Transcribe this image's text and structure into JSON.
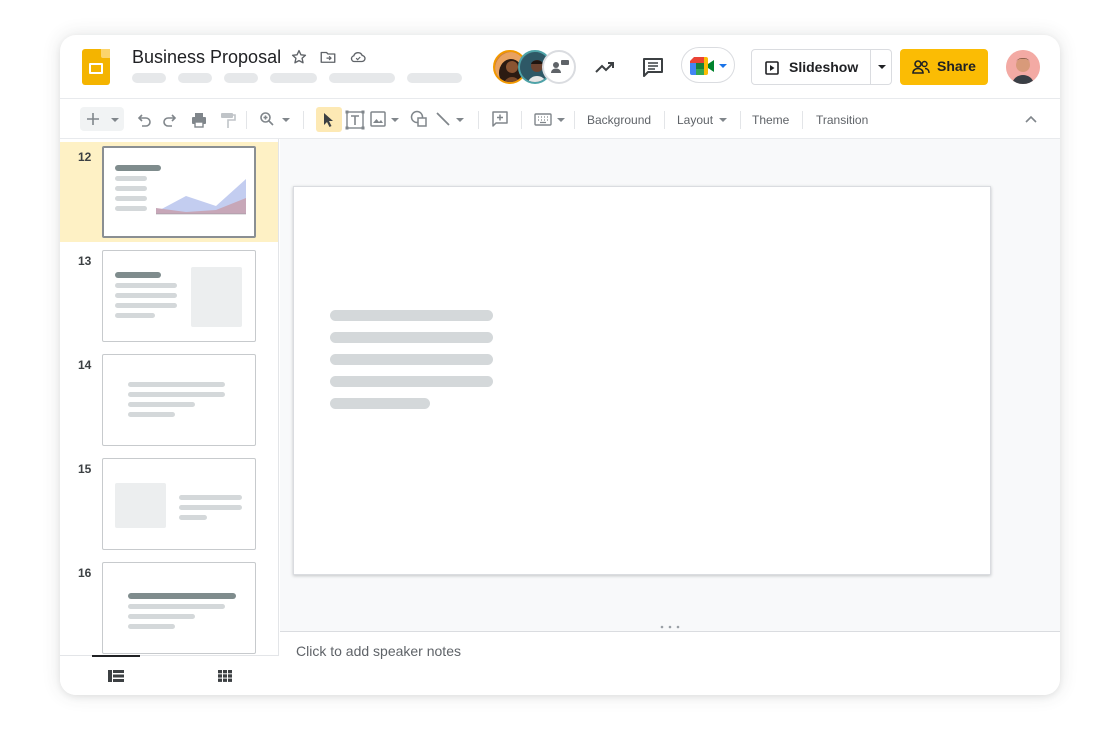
{
  "app": {
    "title": "Business Proposal",
    "brand_color": "#f4b400",
    "accent_color": "#fbbc04"
  },
  "header": {
    "icons": [
      "star-icon",
      "move-to-folder-icon",
      "cloud-saved-icon",
      "activity-trend-icon",
      "comments-icon",
      "google-meet-icon"
    ],
    "collaborators": [
      "collaborator-avatar-1",
      "collaborator-avatar-2",
      "more-collaborators-icon"
    ],
    "slideshow_label": "Slideshow",
    "share_label": "Share"
  },
  "toolbar": {
    "background_label": "Background",
    "layout_label": "Layout",
    "theme_label": "Theme",
    "transition_label": "Transition"
  },
  "filmstrip": {
    "slides": [
      {
        "number": "12",
        "selected": true
      },
      {
        "number": "13",
        "selected": false
      },
      {
        "number": "14",
        "selected": false
      },
      {
        "number": "15",
        "selected": false
      },
      {
        "number": "16",
        "selected": false
      }
    ],
    "views": [
      "filmstrip-view-icon",
      "grid-view-icon"
    ]
  },
  "notes": {
    "placeholder": "Click to add speaker notes"
  }
}
